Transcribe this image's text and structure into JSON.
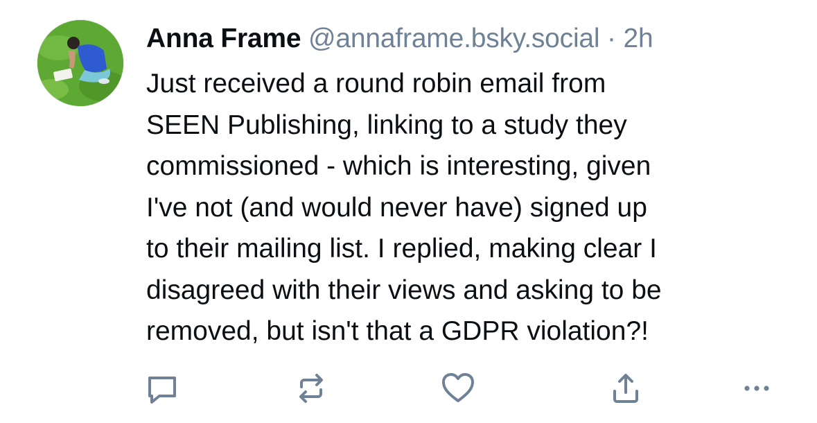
{
  "post": {
    "author_name": "Anna Frame",
    "handle": "@annaframe.bsky.social",
    "separator": "·",
    "time": "2h",
    "text_lines": [
      "Just received a round robin email from",
      "SEEN Publishing, linking to a study they",
      "commissioned - which is interesting, given",
      "I've not (and would never have) signed up",
      "to their mailing list. I replied, making clear I",
      "disagreed with their views and asking to be",
      "removed, but isn't that a GDPR violation?!"
    ]
  },
  "actions": [
    {
      "icon": "reply-icon"
    },
    {
      "icon": "repost-icon"
    },
    {
      "icon": "like-icon"
    },
    {
      "icon": "share-icon"
    },
    {
      "icon": "more-icon"
    }
  ],
  "colors": {
    "text": "#0b0f14",
    "muted": "#6f8196",
    "icon": "#6f8196"
  }
}
